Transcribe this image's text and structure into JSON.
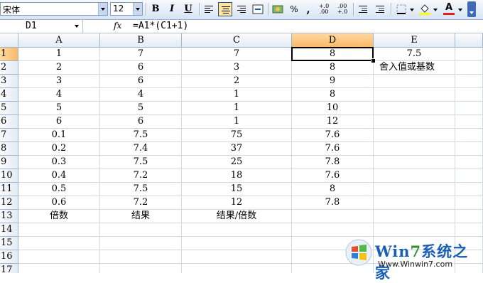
{
  "toolbar": {
    "font_name": "宋体",
    "font_size": "12",
    "bold": "B",
    "italic": "I",
    "underline": "U",
    "percent": "%",
    "comma": ",",
    "inc_decimal": "+.0\n.00",
    "dec_decimal": ".00\n+.0",
    "font_color_label": "A"
  },
  "formula_bar": {
    "name_box": "D1",
    "fx": "fx",
    "formula": "=A1*(C1+1)"
  },
  "columns": [
    "A",
    "B",
    "C",
    "D",
    "E"
  ],
  "selected_column": "D",
  "rows": [
    {
      "n": "1",
      "cells": [
        "1",
        "7",
        "7",
        "8",
        "7.5"
      ]
    },
    {
      "n": "2",
      "cells": [
        "2",
        "6",
        "3",
        "8",
        "舍入值或基数"
      ]
    },
    {
      "n": "3",
      "cells": [
        "3",
        "6",
        "2",
        "9",
        ""
      ]
    },
    {
      "n": "4",
      "cells": [
        "4",
        "4",
        "1",
        "8",
        ""
      ]
    },
    {
      "n": "5",
      "cells": [
        "5",
        "5",
        "1",
        "10",
        ""
      ]
    },
    {
      "n": "6",
      "cells": [
        "6",
        "6",
        "1",
        "12",
        ""
      ]
    },
    {
      "n": "7",
      "cells": [
        "0.1",
        "7.5",
        "75",
        "7.6",
        ""
      ]
    },
    {
      "n": "8",
      "cells": [
        "0.2",
        "7.4",
        "37",
        "7.6",
        ""
      ]
    },
    {
      "n": "9",
      "cells": [
        "0.3",
        "7.5",
        "25",
        "7.8",
        ""
      ]
    },
    {
      "n": "10",
      "cells": [
        "0.4",
        "7.2",
        "18",
        "7.6",
        ""
      ]
    },
    {
      "n": "11",
      "cells": [
        "0.5",
        "7.5",
        "15",
        "8",
        ""
      ]
    },
    {
      "n": "12",
      "cells": [
        "0.6",
        "7.2",
        "12",
        "7.8",
        ""
      ]
    },
    {
      "n": "13",
      "cells": [
        "倍数",
        "结果",
        "结果/倍数",
        "",
        ""
      ]
    },
    {
      "n": "14",
      "cells": [
        "",
        "",
        "",
        "",
        ""
      ]
    },
    {
      "n": "15",
      "cells": [
        "",
        "",
        "",
        "",
        ""
      ]
    },
    {
      "n": "16",
      "cells": [
        "",
        "",
        "",
        "",
        ""
      ]
    },
    {
      "n": "17",
      "cells": [
        "",
        "",
        "",
        "",
        ""
      ]
    }
  ],
  "active_cell": "D1",
  "watermark": {
    "brand_blue": "Win",
    "brand_green": "7",
    "brand_rest": "系统之家",
    "url": "Www.Winwin7.com"
  },
  "colors": {
    "selected_header": "#f9b969",
    "grid_line": "#d0d7e5",
    "toolbar_bg": "#d7e3f4"
  }
}
